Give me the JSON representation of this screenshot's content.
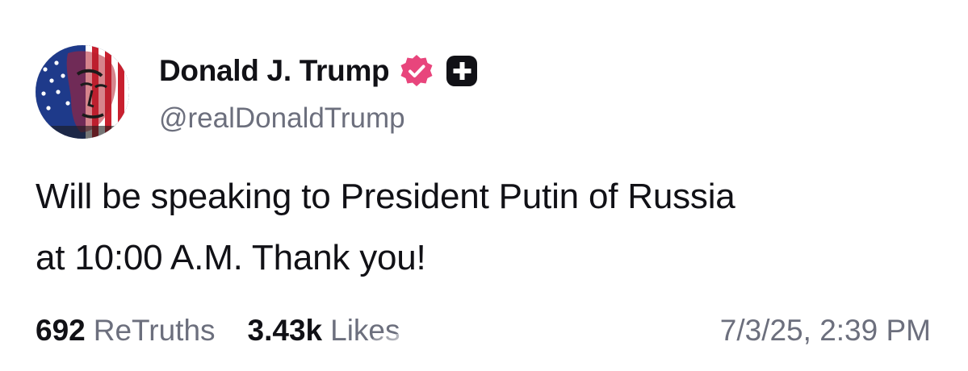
{
  "post": {
    "author": {
      "display_name": "Donald J. Trump",
      "handle": "@realDonaldTrump",
      "avatar_icon": "avatar-flag-portrait",
      "verified_icon": "verified-badge-icon",
      "action_icon": "plus-icon"
    },
    "text_line_1": "Will be speaking to President Putin of Russia",
    "text_line_2": "at 10:00 A.M. Thank you!",
    "stats": {
      "retruths_count": "692",
      "retruths_label": "ReTruths",
      "likes_count": "3.43k",
      "likes_label": "Likes"
    },
    "timestamp": "7/3/25, 2:39 PM"
  },
  "colors": {
    "verified_badge": "#e8457c",
    "action_button": "#111116",
    "primary_text": "#111116",
    "secondary_text": "#6c6f7d"
  }
}
